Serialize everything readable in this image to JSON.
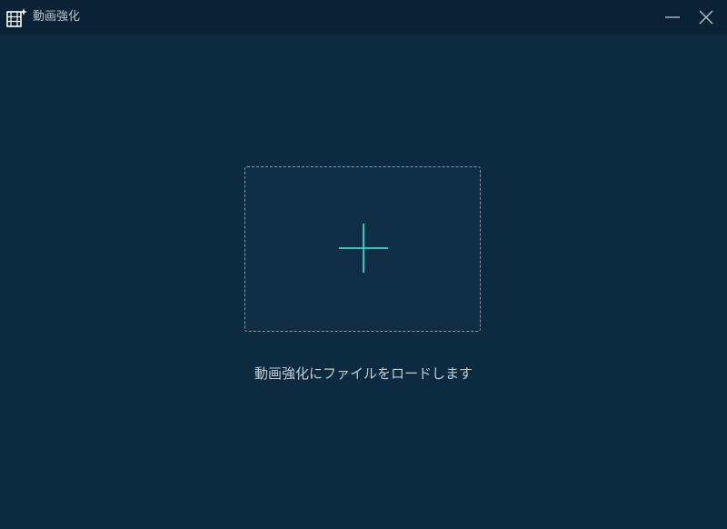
{
  "window": {
    "title": "動画強化",
    "app_icon": "film-sparkle-icon",
    "minimize_icon": "minimize-icon",
    "close_icon": "close-icon"
  },
  "main": {
    "dropzone_icon": "plus-icon",
    "hint": "動画強化にファイルをロードします"
  },
  "colors": {
    "background": "#0d2b40",
    "titlebar": "#0b2236",
    "accent": "#2ec8c0",
    "dash_border": "#8c98a2",
    "text": "#c2ccd3"
  }
}
